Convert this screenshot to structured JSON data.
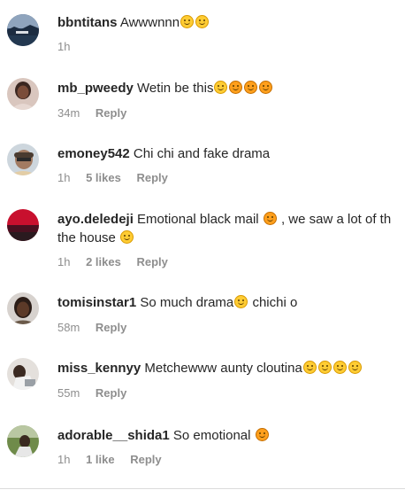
{
  "comments": [
    {
      "username": "bbntitans",
      "text": "Awwwnnn",
      "emojis": [
        "disappointed-face",
        "disappointed-face"
      ],
      "time": "1h",
      "likes": "",
      "reply": ""
    },
    {
      "username": "mb_pweedy",
      "text": "Wetin be this",
      "emojis": [
        "eye-roll-face",
        "rolling-laughing-face",
        "rolling-laughing-face",
        "rolling-laughing-face"
      ],
      "time": "34m",
      "likes": "",
      "reply": "Reply"
    },
    {
      "username": "emoney542",
      "text": "Chi chi and fake drama",
      "emojis": [],
      "time": "1h",
      "likes": "5 likes",
      "reply": "Reply"
    },
    {
      "username": "ayo.deledeji",
      "text": "Emotional black mail",
      "text_after": ", we saw a lot of th",
      "text_line2": "the house",
      "emojis": [
        "tired-face"
      ],
      "emojis_line2": [
        "grinning-sweat-face"
      ],
      "time": "1h",
      "likes": "2 likes",
      "reply": "Reply"
    },
    {
      "username": "tomisinstar1",
      "text": "So much drama",
      "text_after": "chichi o",
      "emojis": [
        "grinning-sweat-face"
      ],
      "time": "58m",
      "likes": "",
      "reply": "Reply"
    },
    {
      "username": "miss_kennyy",
      "text": "Metchewww aunty cloutina",
      "emojis": [
        "grinning-sweat-face",
        "grinning-sweat-face",
        "grinning-sweat-face",
        "grinning-sweat-face"
      ],
      "time": "55m",
      "likes": "",
      "reply": "Reply"
    },
    {
      "username": "adorable__shida1",
      "text": "So emotional",
      "emojis": [
        "tired-face"
      ],
      "time": "1h",
      "likes": "1 like",
      "reply": "Reply"
    }
  ],
  "colors": {
    "username": "#262626",
    "meta": "#8e8e8e",
    "emoji_yellow": "#ffcc33"
  }
}
